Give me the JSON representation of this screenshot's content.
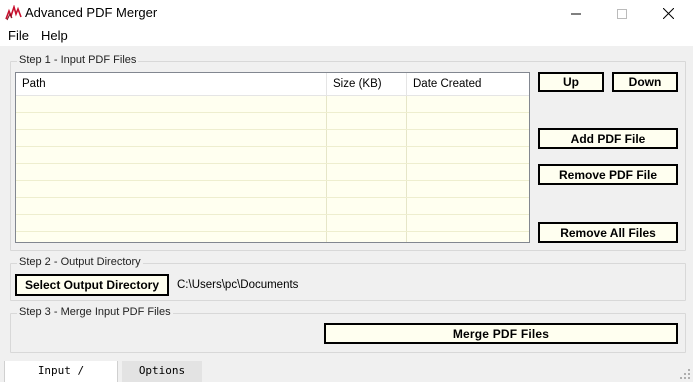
{
  "window": {
    "title": "Advanced PDF Merger",
    "icon": "pdf-merger-logo-icon"
  },
  "menu": {
    "file": "File",
    "help": "Help"
  },
  "step1": {
    "title": "Step 1 - Input PDF Files",
    "columns": [
      "Path",
      "Size (KB)",
      "Date Created"
    ],
    "rows": [],
    "buttons": {
      "up": "Up",
      "down": "Down",
      "add": "Add PDF File",
      "remove": "Remove PDF File",
      "remove_all": "Remove All Files"
    }
  },
  "step2": {
    "title": "Step 2 - Output Directory",
    "select_button": "Select Output Directory",
    "output_path": "C:\\Users\\pc\\Documents"
  },
  "step3": {
    "title": "Step 3 - Merge Input PDF Files",
    "merge_button": "Merge PDF Files"
  },
  "tabs": [
    {
      "label": "Input / Output",
      "active": true
    },
    {
      "label": "Options",
      "active": false
    }
  ],
  "colors": {
    "list_background": "#fffff0",
    "window_background": "#f0f0f0",
    "icon_red": "#c8102e"
  }
}
